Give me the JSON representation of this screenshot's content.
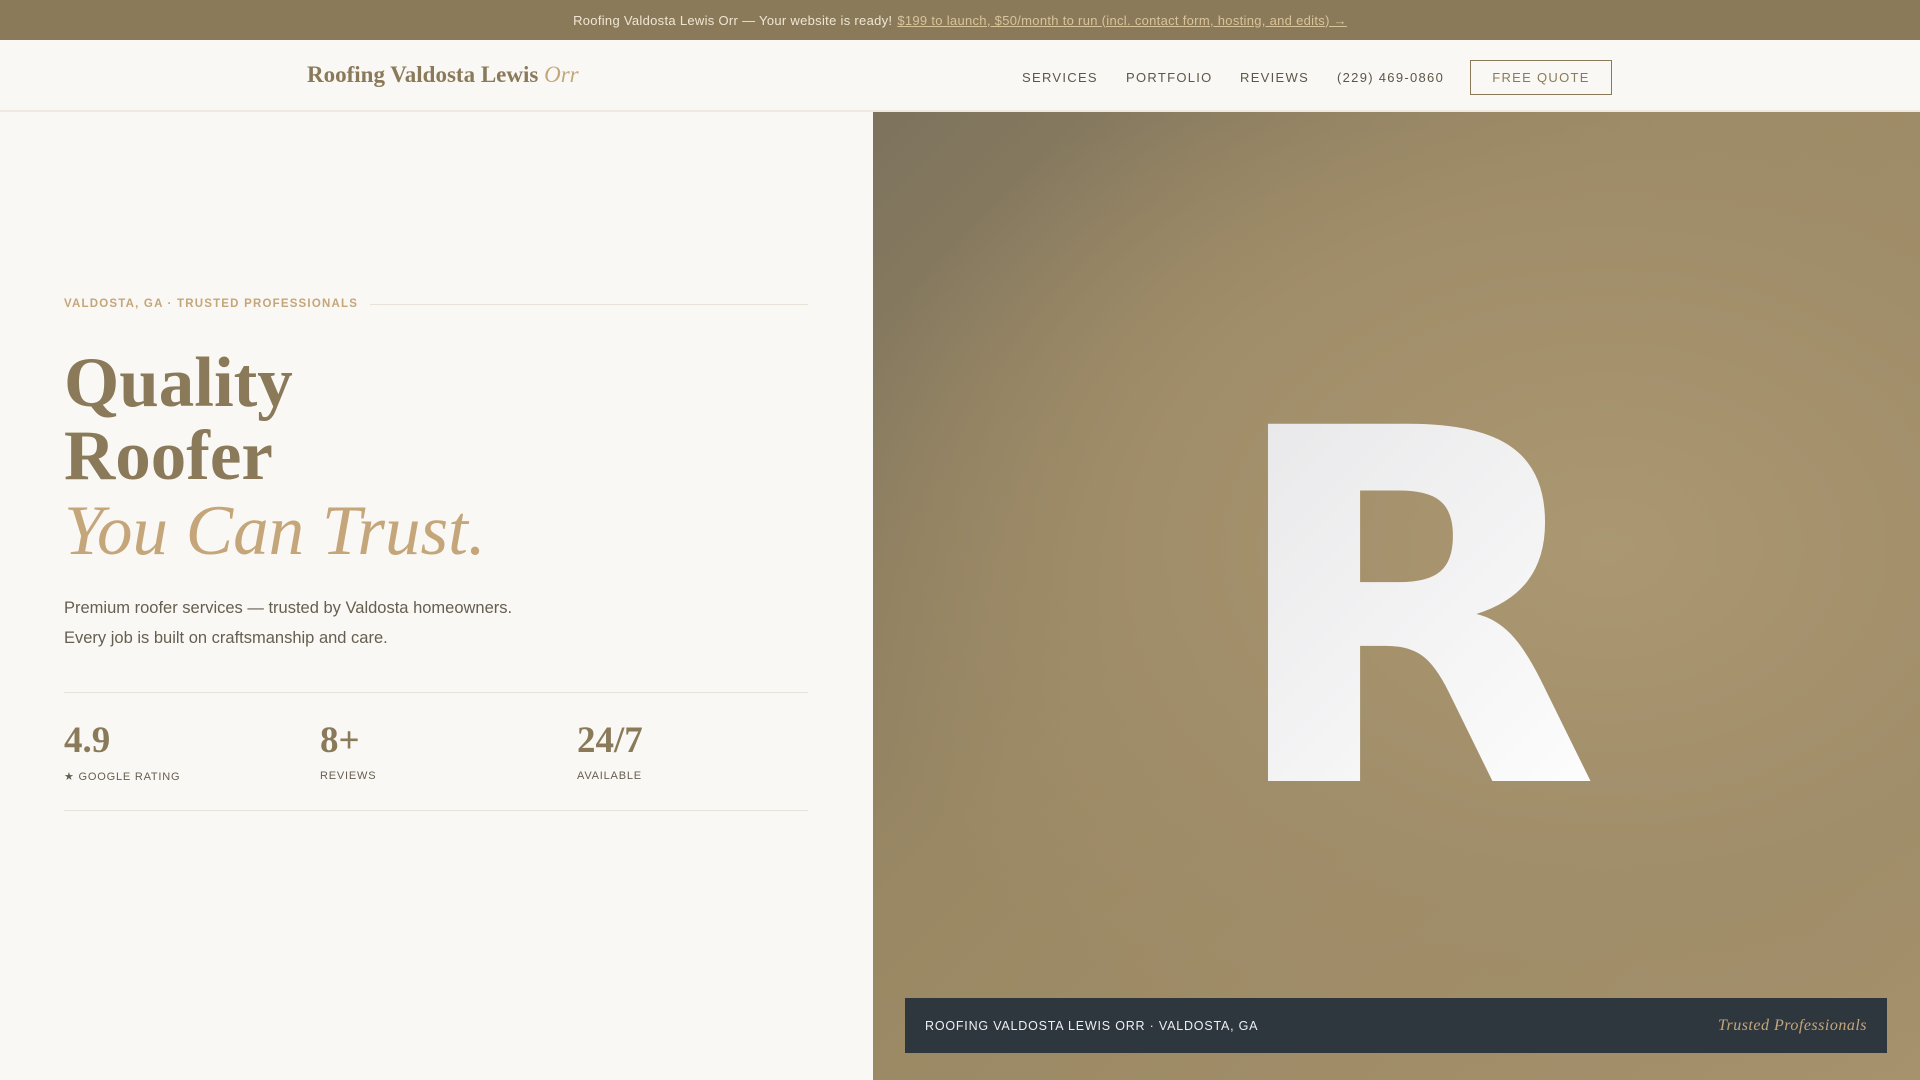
{
  "banner": {
    "text": "Roofing Valdosta Lewis Orr — Your website is ready!",
    "link": "$199 to launch, $50/month to run (incl. contact form, hosting, and edits) →"
  },
  "nav": {
    "logo_main": "Roofing Valdosta Lewis",
    "logo_accent": "Orr",
    "items": [
      "SERVICES",
      "PORTFOLIO",
      "REVIEWS",
      "(229) 469-0860"
    ],
    "cta": "FREE QUOTE"
  },
  "hero": {
    "eyebrow": "VALDOSTA, GA · TRUSTED PROFESSIONALS",
    "line1": "Quality",
    "line2": "Roofer",
    "line3": "You Can Trust.",
    "para1": "Premium roofer services — trusted by Valdosta homeowners.",
    "para2": "Every job is built on craftsmanship and care.",
    "stats": [
      {
        "value": "4.9",
        "label": "★ GOOGLE RATING"
      },
      {
        "value": "8+",
        "label": "REVIEWS"
      },
      {
        "value": "24/7",
        "label": "AVAILABLE"
      }
    ]
  },
  "visual": {
    "letter": "R",
    "caption_left": "ROOFING VALDOSTA LEWIS ORR · VALDOSTA, GA",
    "caption_right": "Trusted Professionals"
  },
  "colors": {
    "brand": "#8a7a5a",
    "accent": "#c4a67a",
    "dark": "#2e363e"
  }
}
